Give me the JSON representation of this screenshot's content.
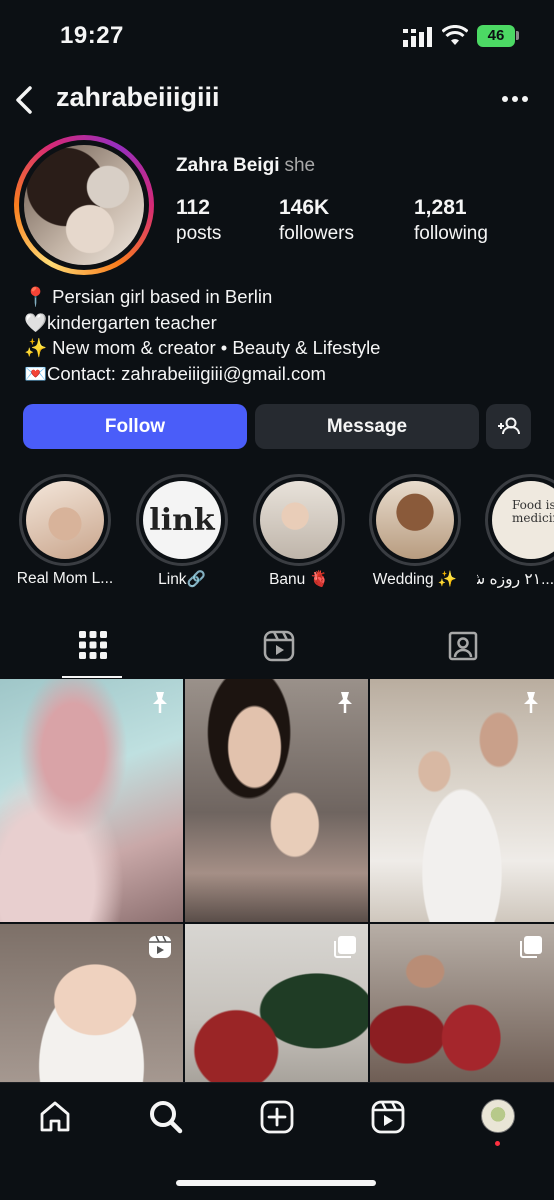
{
  "status_bar": {
    "time": "19:27",
    "battery": "46"
  },
  "header": {
    "username": "zahrabeiiigiii"
  },
  "profile": {
    "full_name": "Zahra Beigi",
    "pronouns": "she",
    "stats": [
      {
        "value": "112",
        "label": "posts"
      },
      {
        "value": "146K",
        "label": "followers"
      },
      {
        "value": "1,281",
        "label": "following"
      }
    ],
    "bio": [
      "📍 Persian girl based in Berlin",
      "🤍kindergarten teacher",
      "✨ New mom & creator • Beauty & Lifestyle",
      "💌Contact: zahrabeiiigiii@gmail.com"
    ]
  },
  "actions": {
    "follow": "Follow",
    "message": "Message"
  },
  "highlights": [
    {
      "label": "Real Mom L..."
    },
    {
      "label": "Link🔗",
      "logo_text": "link"
    },
    {
      "label": "Banu 🫀"
    },
    {
      "label": "Wedding ✨"
    },
    {
      "label": "...۲۱ روزه ش",
      "logo_text": "Food is medicine"
    }
  ],
  "tabs": [
    {
      "name": "posts-grid",
      "icon": "grid-icon",
      "active": true
    },
    {
      "name": "reels",
      "icon": "reels-icon",
      "active": false
    },
    {
      "name": "tagged",
      "icon": "tagged-icon",
      "active": false
    }
  ],
  "posts": [
    {
      "badge": "pin-icon"
    },
    {
      "badge": "pin-icon"
    },
    {
      "badge": "pin-icon"
    },
    {
      "badge": "reels-icon"
    },
    {
      "badge": "carousel-icon"
    },
    {
      "badge": "carousel-icon"
    }
  ],
  "bottom_nav": [
    "home-icon",
    "search-icon",
    "create-icon",
    "reels-icon",
    "profile-icon"
  ],
  "colors": {
    "follow_button": "#4a5df9",
    "background": "#0c1014",
    "secondary_button": "#262a30",
    "battery": "#4cd964"
  }
}
